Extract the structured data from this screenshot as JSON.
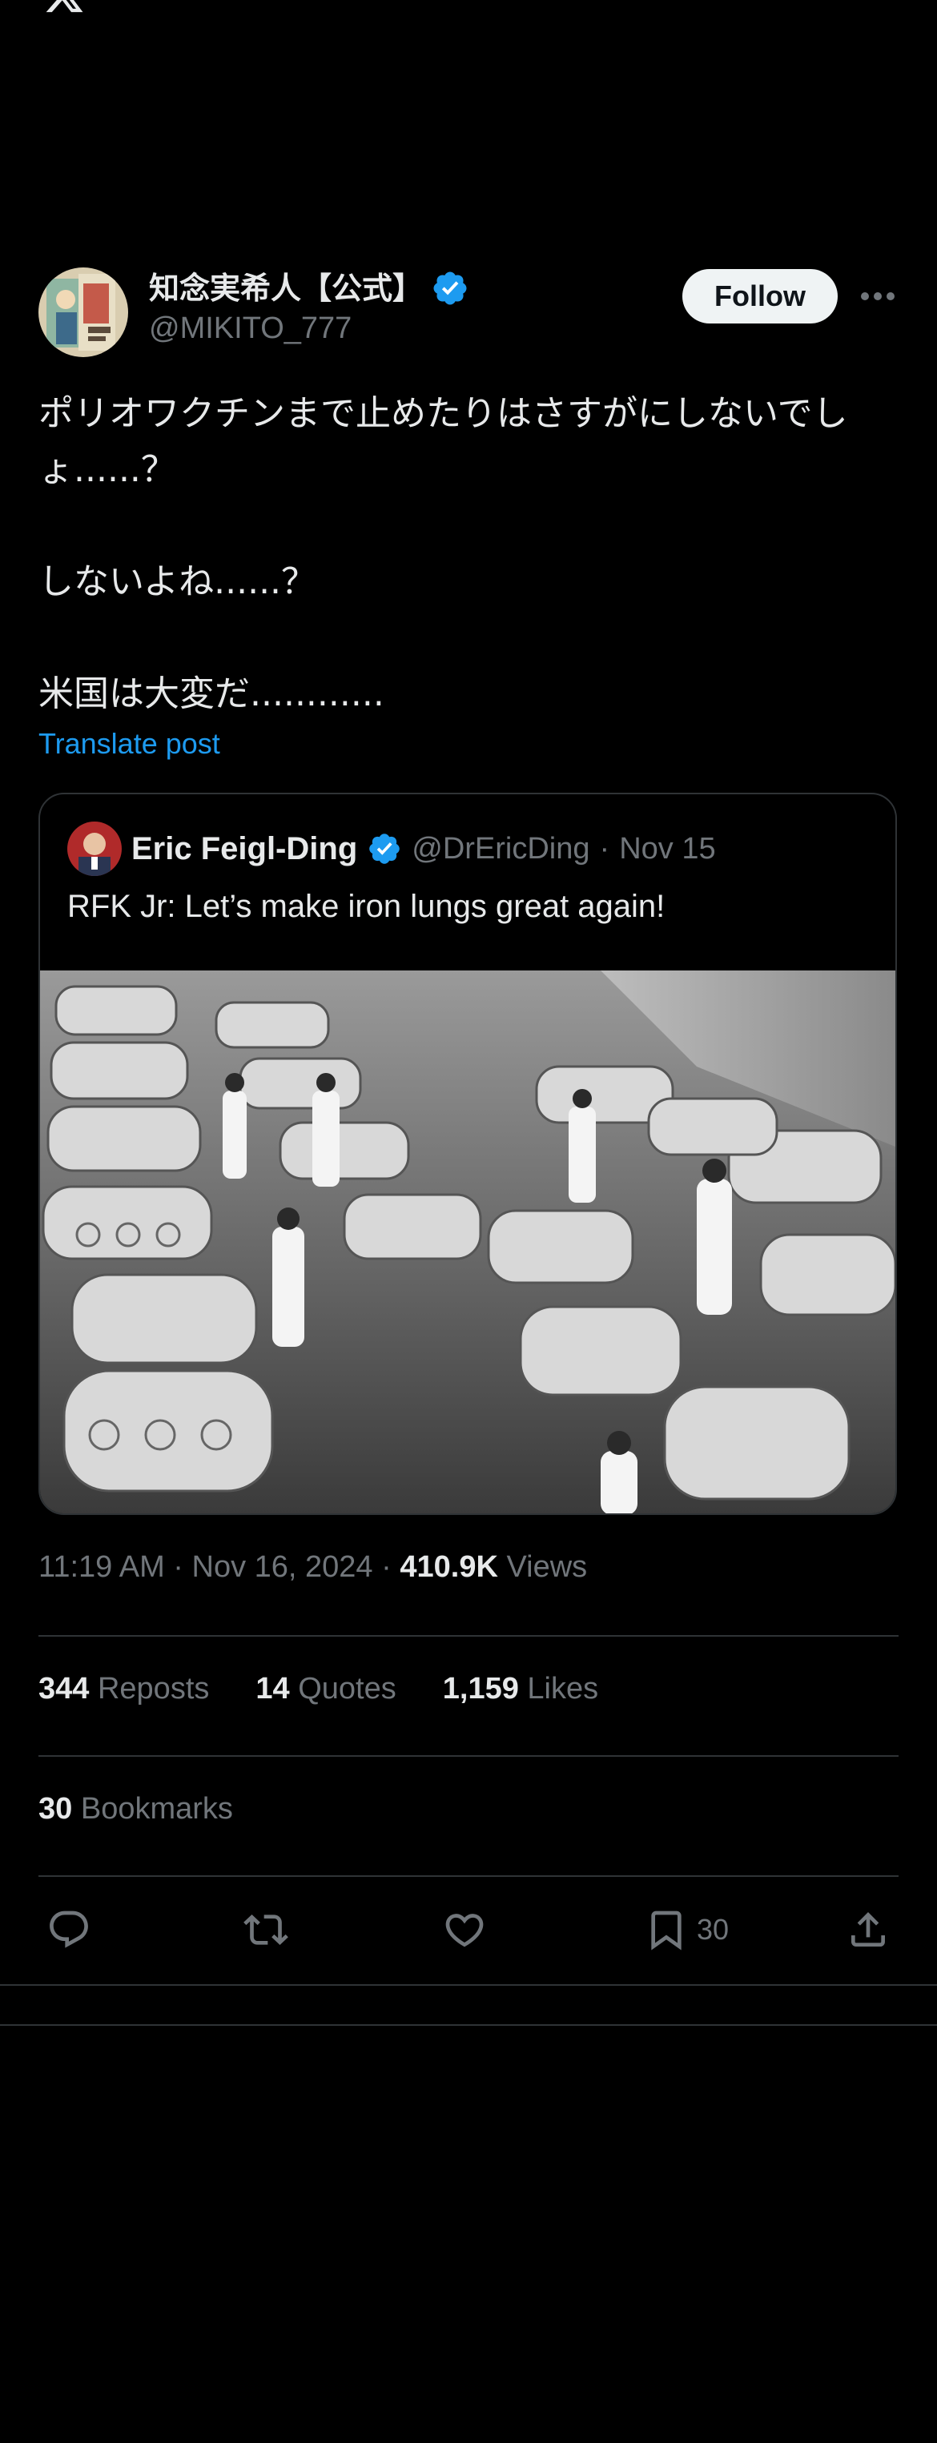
{
  "colors": {
    "background": "#000000",
    "text": "#e7e9ea",
    "secondary_text": "#71767b",
    "link": "#1d9bf0",
    "verified": "#1d9bf0",
    "divider": "#2f3336"
  },
  "top_bar": {
    "logo_icon": "x-logo-icon"
  },
  "author": {
    "display_name": "知念実希人【公式】",
    "handle": "@MIKITO_777",
    "verified": true,
    "follow_label": "Follow",
    "more_icon": "more-icon"
  },
  "post": {
    "text": "ポリオワクチンまで止めたりはさすがにしないでしょ......？\n\nしないよね......？\n\n米国は大変だ............",
    "translate_label": "Translate post"
  },
  "quoted_post": {
    "display_name": "Eric Feigl-Ding",
    "handle": "@DrEricDing",
    "separator": "·",
    "date": "Nov 15",
    "verified": true,
    "text": "RFK Jr: Let’s make iron lungs great again!",
    "image_alt": "black-and-white photo of a ward filled with rows of iron lungs attended by nurses"
  },
  "meta": {
    "time": "11:19 AM",
    "separator": "·",
    "date": "Nov 16, 2024",
    "views_count": "410.9K",
    "views_label": "Views"
  },
  "stats": {
    "reposts_count": "344",
    "reposts_label": "Reposts",
    "quotes_count": "14",
    "quotes_label": "Quotes",
    "likes_count": "1,159",
    "likes_label": "Likes",
    "bookmarks_count": "30",
    "bookmarks_label": "Bookmarks"
  },
  "actions": {
    "reply_icon": "reply-icon",
    "repost_icon": "repost-icon",
    "like_icon": "heart-icon",
    "bookmark_icon": "bookmark-icon",
    "bookmark_count": "30",
    "share_icon": "share-icon"
  }
}
